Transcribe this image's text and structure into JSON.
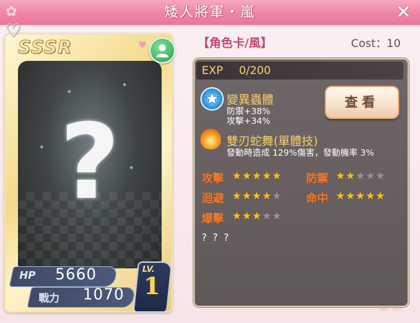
{
  "window": {
    "title": "矮人將軍・嵐",
    "close_glyph": "✕"
  },
  "card": {
    "rarity": "SSSR",
    "placeholder_glyph": "?",
    "hp_label": "HP",
    "hp_value": "5660",
    "power_label": "戰力",
    "power_value": "1070",
    "level_label": "LV.",
    "level_value": "1",
    "icons": [
      "heart-lock-icon",
      "mini-heart-icon",
      "avatar-icon"
    ]
  },
  "info": {
    "card_type": "【角色卡/風】",
    "cost": "Cost：10",
    "exp_label": "EXP",
    "exp_value": "0/200",
    "view_button": "查看",
    "skills": [
      {
        "name": "變異蟲體",
        "lines": [
          "防禦+38%",
          "攻擊+34%"
        ],
        "icon": "star-badge-icon"
      },
      {
        "name": "雙刃蛇舞(單體技)",
        "lines": [
          "發動時造成 129%傷害，發動機率 3%"
        ],
        "icon": "flame-icon"
      }
    ],
    "stats": [
      {
        "label": "攻擊",
        "stars": 5,
        "max": 5
      },
      {
        "label": "防禦",
        "stars": 2,
        "max": 5
      },
      {
        "label": "迴避",
        "stars": 4,
        "max": 5
      },
      {
        "label": "命中",
        "stars": 5,
        "max": 5
      },
      {
        "label": "爆擊",
        "stars": 3,
        "max": 5
      }
    ],
    "description": "? ? ?"
  },
  "colors": {
    "titlebar": "#ee86a4",
    "accent_gold": "#f3d57a",
    "stat_label": "#f07a2e",
    "star_on": "#f6c21a",
    "star_off": "#9c9292"
  }
}
